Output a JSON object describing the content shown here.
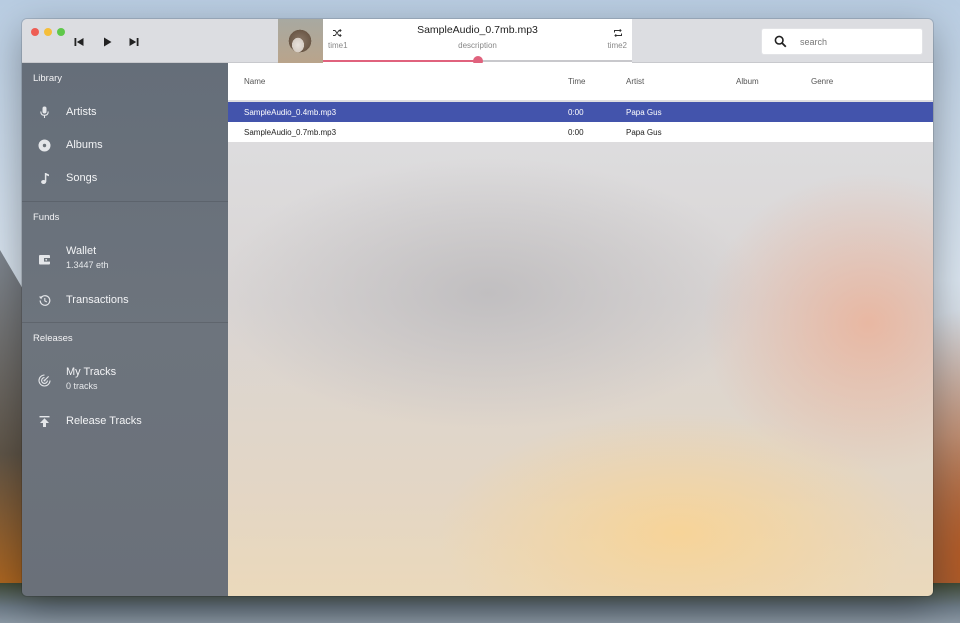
{
  "colors": {
    "accent_pink": "#e0627d",
    "selection_blue": "#4354ac",
    "sidebar_bg": "#6a717b",
    "titlebar_bg": "#dcdde1"
  },
  "window": {
    "traffic_lights": [
      "close",
      "minimize",
      "maximize"
    ]
  },
  "transport": {
    "previous_icon": "skip-previous-icon",
    "play_icon": "play-icon",
    "next_icon": "skip-next-icon"
  },
  "now_playing": {
    "title": "SampleAudio_0.7mb.mp3",
    "description": "description",
    "time1": "time1",
    "time2": "time2",
    "shuffle_icon": "shuffle-icon",
    "repeat_icon": "repeat-icon",
    "progress": 0.5,
    "artwork": "kitten-album-art"
  },
  "search": {
    "placeholder": "search",
    "value": ""
  },
  "sidebar": {
    "sections": [
      {
        "title": "Library",
        "items": [
          {
            "label": "Artists",
            "icon": "microphone-icon"
          },
          {
            "label": "Albums",
            "icon": "disc-icon"
          },
          {
            "label": "Songs",
            "icon": "music-note-icon"
          }
        ]
      },
      {
        "title": "Funds",
        "items": [
          {
            "label": "Wallet",
            "sublabel": "1.3447 eth",
            "icon": "wallet-icon"
          },
          {
            "label": "Transactions",
            "icon": "history-icon"
          }
        ]
      },
      {
        "title": "Releases",
        "items": [
          {
            "label": "My Tracks",
            "sublabel": "0 tracks",
            "icon": "radar-icon"
          },
          {
            "label": "Release Tracks",
            "icon": "upload-icon"
          }
        ]
      }
    ]
  },
  "table": {
    "columns": [
      "Name",
      "Time",
      "Artist",
      "Album",
      "Genre"
    ],
    "rows": [
      {
        "name": "SampleAudio_0.4mb.mp3",
        "time": "0:00",
        "artist": "Papa Gus",
        "album": "",
        "genre": "",
        "selected": true
      },
      {
        "name": "SampleAudio_0.7mb.mp3",
        "time": "0:00",
        "artist": "Papa Gus",
        "album": "",
        "genre": "",
        "selected": false
      }
    ]
  }
}
